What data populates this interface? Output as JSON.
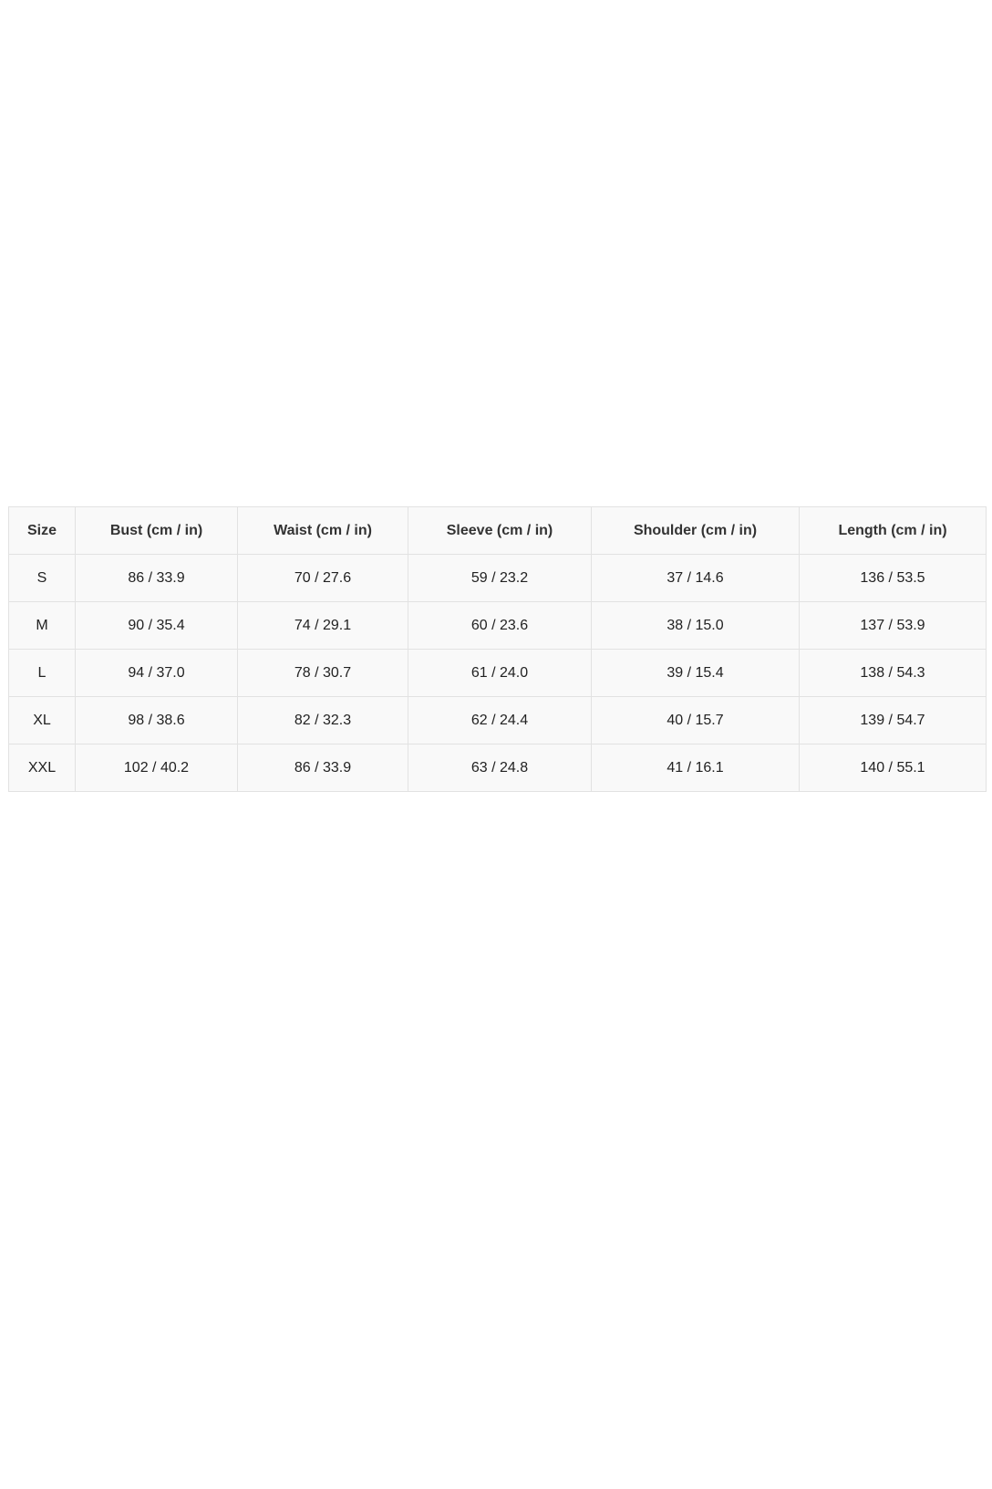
{
  "size_chart": {
    "headers": [
      "Size",
      "Bust (cm / in)",
      "Waist (cm / in)",
      "Sleeve (cm / in)",
      "Shoulder (cm / in)",
      "Length (cm / in)"
    ],
    "rows": [
      [
        "S",
        "86 / 33.9",
        "70 / 27.6",
        "59 / 23.2",
        "37 / 14.6",
        "136 / 53.5"
      ],
      [
        "M",
        "90 / 35.4",
        "74 / 29.1",
        "60 / 23.6",
        "38 / 15.0",
        "137 / 53.9"
      ],
      [
        "L",
        "94 / 37.0",
        "78 / 30.7",
        "61 / 24.0",
        "39 / 15.4",
        "138 / 54.3"
      ],
      [
        "XL",
        "98 / 38.6",
        "82 / 32.3",
        "62 / 24.4",
        "40 / 15.7",
        "139 / 54.7"
      ],
      [
        "XXL",
        "102 / 40.2",
        "86 / 33.9",
        "63 / 24.8",
        "41 / 16.1",
        "140 / 55.1"
      ]
    ]
  },
  "colors": {
    "table_background": "#f9f9f9",
    "border": "#e2e2e2",
    "text": "#222222"
  }
}
